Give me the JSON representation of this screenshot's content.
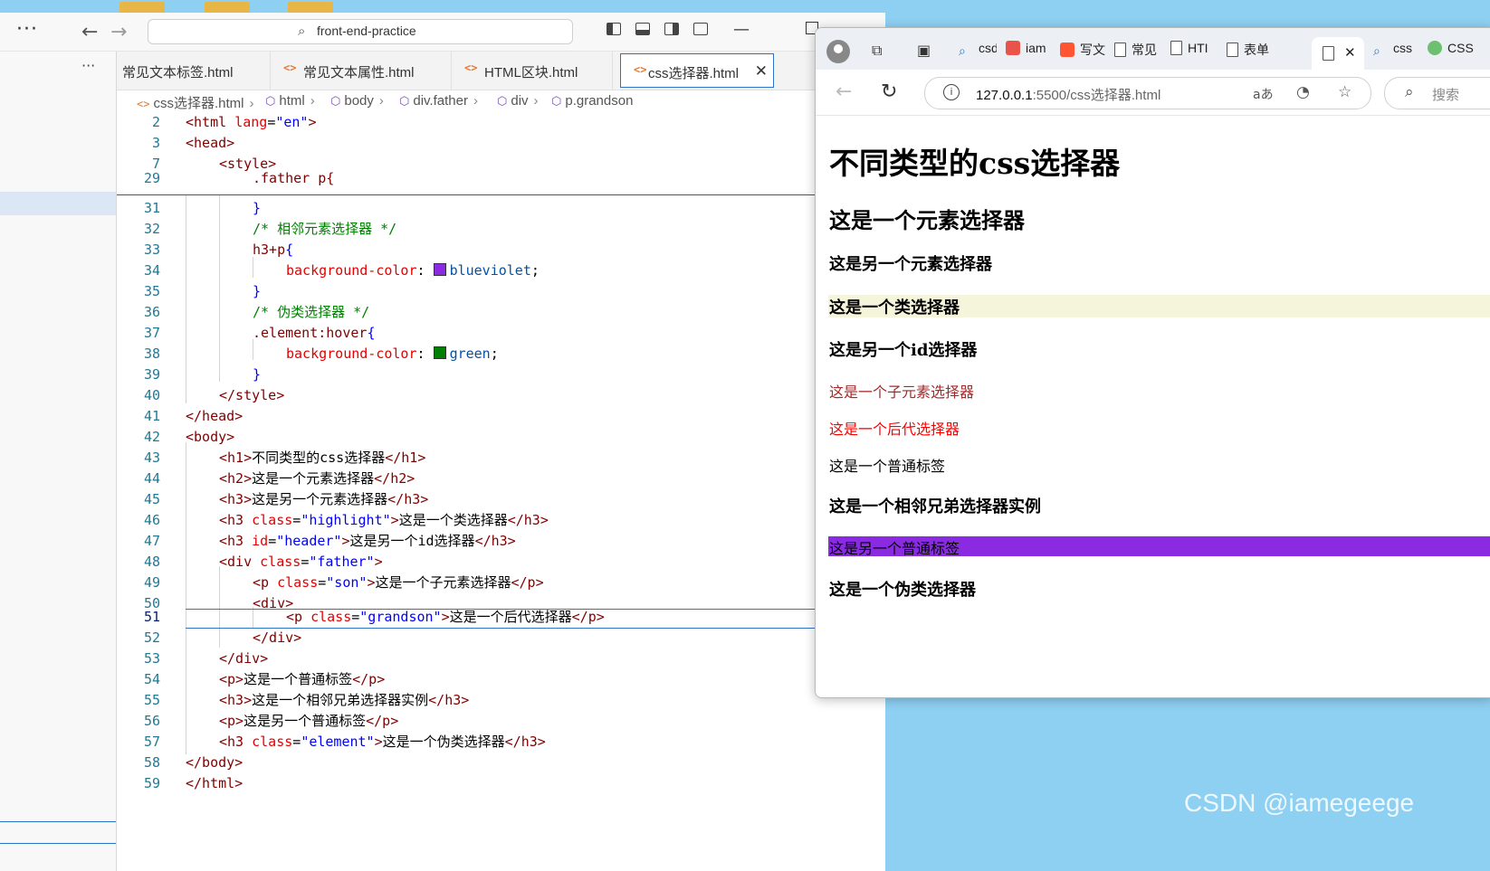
{
  "vscode": {
    "menu_dots": "···",
    "command_center": "front-end-practice",
    "sidebar_more": "···",
    "tabs": [
      {
        "label": "常见文本标签.html"
      },
      {
        "label": "常见文本属性.html"
      },
      {
        "label": "HTML区块.html"
      },
      {
        "label": "css选择器.html"
      }
    ],
    "breadcrumb": [
      "css选择器.html",
      "html",
      "body",
      "div.father",
      "div",
      "p.grandson"
    ],
    "colors": {
      "accent": "#2b74c7",
      "swatch_blueviolet": "#8a2be2",
      "swatch_green": "#008000"
    },
    "lines": {
      "n2": "2",
      "n3": "3",
      "n7": "7",
      "n29": "29",
      "n31": "31",
      "n32": "32",
      "n33": "33",
      "n34": "34",
      "n35": "35",
      "n36": "36",
      "n37": "37",
      "n38": "38",
      "n39": "39",
      "n40": "40",
      "n41": "41",
      "n42": "42",
      "n43": "43",
      "n44": "44",
      "n45": "45",
      "n46": "46",
      "n47": "47",
      "n48": "48",
      "n49": "49",
      "n50": "50",
      "n51": "51",
      "n52": "52",
      "n53": "53",
      "n54": "54",
      "n55": "55",
      "n56": "56",
      "n57": "57",
      "n58": "58",
      "n59": "59",
      "l2_a": "<html ",
      "l2_b": "lang",
      "l2_c": "=",
      "l2_d": "\"en\"",
      "l2_e": ">",
      "l3": "<head>",
      "l7": "<style>",
      "l29": ".father p{",
      "l31": "}",
      "l32": "/* 相邻元素选择器 */",
      "l33_a": "h3+p",
      "l33_b": "{",
      "l34_a": "background-color",
      "l34_b": ": ",
      "l34_c": "blueviolet",
      "l34_d": ";",
      "l35": "}",
      "l36": "/* 伪类选择器 */",
      "l37_a": ".element:hover",
      "l37_b": "{",
      "l38_a": "background-color",
      "l38_b": ": ",
      "l38_c": "green",
      "l38_d": ";",
      "l39": "}",
      "l40": "</style>",
      "l41": "</head>",
      "l42": "<body>",
      "l43_a": "<h1>",
      "l43_b": "不同类型的css选择器",
      "l43_c": "</h1>",
      "l44_a": "<h2>",
      "l44_b": "这是一个元素选择器",
      "l44_c": "</h2>",
      "l45_a": "<h3>",
      "l45_b": "这是另一个元素选择器",
      "l45_c": "</h3>",
      "l46_a": "<h3 ",
      "l46_b": "class",
      "l46_c": "=",
      "l46_d": "\"highlight\"",
      "l46_e": ">",
      "l46_f": "这是一个类选择器",
      "l46_g": "</h3>",
      "l47_a": "<h3 ",
      "l47_b": "id",
      "l47_c": "=",
      "l47_d": "\"header\"",
      "l47_e": ">",
      "l47_f": "这是另一个id选择器",
      "l47_g": "</h3>",
      "l48_a": "<div ",
      "l48_b": "class",
      "l48_c": "=",
      "l48_d": "\"father\"",
      "l48_e": ">",
      "l49_a": "<p ",
      "l49_b": "class",
      "l49_c": "=",
      "l49_d": "\"son\"",
      "l49_e": ">",
      "l49_f": "这是一个子元素选择器",
      "l49_g": "</p>",
      "l50": "<div>",
      "l51_a": "<p ",
      "l51_b": "class",
      "l51_c": "=",
      "l51_d": "\"grandson\"",
      "l51_e": ">",
      "l51_f": "这是一个后代选择器",
      "l51_g": "</p>",
      "l52": "</div>",
      "l53": "</div>",
      "l54_a": "<p>",
      "l54_b": "这是一个普通标签",
      "l54_c": "</p>",
      "l55_a": "<h3>",
      "l55_b": "这是一个相邻兄弟选择器实例",
      "l55_c": "</h3>",
      "l56_a": "<p>",
      "l56_b": "这是另一个普通标签",
      "l56_c": "</p>",
      "l57_a": "<h3 ",
      "l57_b": "class",
      "l57_c": "=",
      "l57_d": "\"element\"",
      "l57_e": ">",
      "l57_f": "这是一个伪类选择器",
      "l57_g": "</h3>",
      "l58": "</body>",
      "l59": "</html>"
    }
  },
  "browser": {
    "tabs": [
      "csd",
      "iam",
      "写文",
      "常见",
      "HTI",
      "表单",
      "",
      "css",
      "CSS"
    ],
    "url_host": "127.0.0.1",
    "url_path": ":5500/css选择器.html",
    "search_placeholder": "搜索",
    "read_aloud": "aあ",
    "colors": {
      "highlight_bg": "#f5f5dc",
      "son_color": "#a52a2a",
      "grandson_color": "#ff0000",
      "adjacent_bg": "#8a2be2"
    },
    "page": {
      "h1": "不同类型的css选择器",
      "h2": "这是一个元素选择器",
      "h3_a": "这是另一个元素选择器",
      "h3_highlight": "这是一个类选择器",
      "h3_header": "这是另一个id选择器",
      "p_son": "这是一个子元素选择器",
      "p_grandson": "这是一个后代选择器",
      "p_normal": "这是一个普通标签",
      "h3_adjacent": "这是一个相邻兄弟选择器实例",
      "p_adjacent": "这是另一个普通标签",
      "h3_element": "这是一个伪类选择器"
    }
  },
  "watermark": "CSDN @iamegeege"
}
